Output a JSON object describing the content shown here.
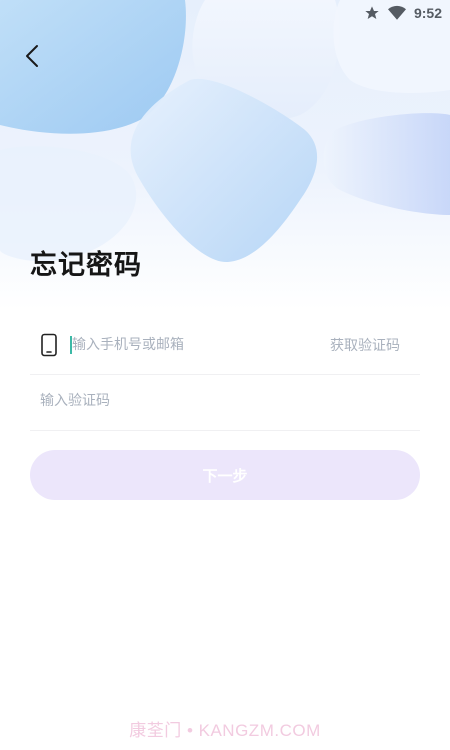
{
  "status_bar": {
    "time": "9:52",
    "icons": [
      "star-icon",
      "wifi-icon"
    ]
  },
  "header": {
    "back_icon": "chevron-left-icon",
    "title": "忘记密码"
  },
  "form": {
    "phone_field": {
      "icon": "phone-icon",
      "placeholder": "输入手机号或邮箱",
      "value": ""
    },
    "get_code_label": "获取验证码",
    "code_field": {
      "placeholder": "输入验证码",
      "value": ""
    },
    "next_button_label": "下一步"
  },
  "watermark": "康荃门 • KANGZM.COM",
  "colors": {
    "cursor": "#3cb9a6",
    "placeholder": "#a9b1bd",
    "button_bg_disabled": "#ece6fb",
    "hero_blue": "#a9d0f5"
  }
}
